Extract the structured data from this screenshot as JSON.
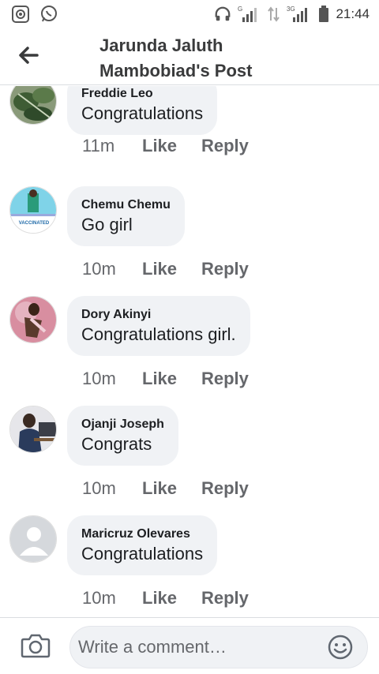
{
  "status_bar": {
    "time": "21:44",
    "network_label": "3G",
    "left_icons": [
      "screen-record-icon",
      "whatsapp-icon"
    ],
    "right_icons": [
      "headphones-icon",
      "signal-icon",
      "data-arrows-icon",
      "signal-3g-icon",
      "battery-icon"
    ]
  },
  "header": {
    "title_line1": "Jarunda Jaluth",
    "title_line2": "Mambobiad's Post",
    "back_icon": "back-arrow-icon"
  },
  "comments": [
    {
      "author": "Freddie Leo",
      "text": "Congratulations",
      "time": "11m",
      "like": "Like",
      "reply": "Reply",
      "avatar": "plant-photo"
    },
    {
      "author": "Chemu Chemu",
      "text": "Go girl",
      "time": "10m",
      "like": "Like",
      "reply": "Reply",
      "avatar": "vaccinated-frame-photo",
      "avatar_text": "VACCINATED"
    },
    {
      "author": "Dory Akinyi",
      "text": "Congratulations girl.",
      "time": "10m",
      "like": "Like",
      "reply": "Reply",
      "avatar": "person-photo"
    },
    {
      "author": "Ojanji Joseph",
      "text": "Congrats",
      "time": "10m",
      "like": "Like",
      "reply": "Reply",
      "avatar": "person-desk-photo"
    },
    {
      "author": "Maricruz Olevares",
      "text": "Congratulations",
      "time": "10m",
      "like": "Like",
      "reply": "Reply",
      "avatar": "default-avatar"
    }
  ],
  "composer": {
    "placeholder": "Write a comment…",
    "camera_icon": "camera-icon",
    "emoji_icon": "emoji-icon"
  },
  "colors": {
    "bubble": "#f0f2f5",
    "secondary_text": "#65676b",
    "primary_text": "#1c1e21"
  }
}
